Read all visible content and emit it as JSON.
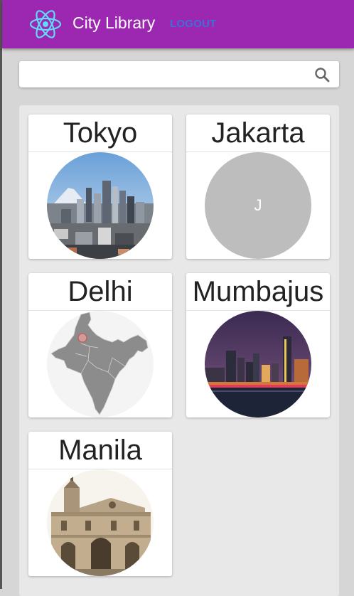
{
  "app": {
    "title": "City Library",
    "logout_label": "LOGOUT"
  },
  "search": {
    "value": "",
    "placeholder": ""
  },
  "cities": [
    {
      "name": "Tokyo",
      "image": "tokyo-skyline-with-mount-fuji"
    },
    {
      "name": "Jakarta",
      "avatar_letter": "J"
    },
    {
      "name": "Delhi",
      "image": "india-map"
    },
    {
      "name": "Mumbajus",
      "image": "mumbai-night-skyline"
    },
    {
      "name": "Manila",
      "image": "manila-cathedral"
    }
  ],
  "colors": {
    "appbar": "#9c27b0",
    "logout": "#3f6fd8",
    "avatar_placeholder": "#bdbdbd"
  }
}
